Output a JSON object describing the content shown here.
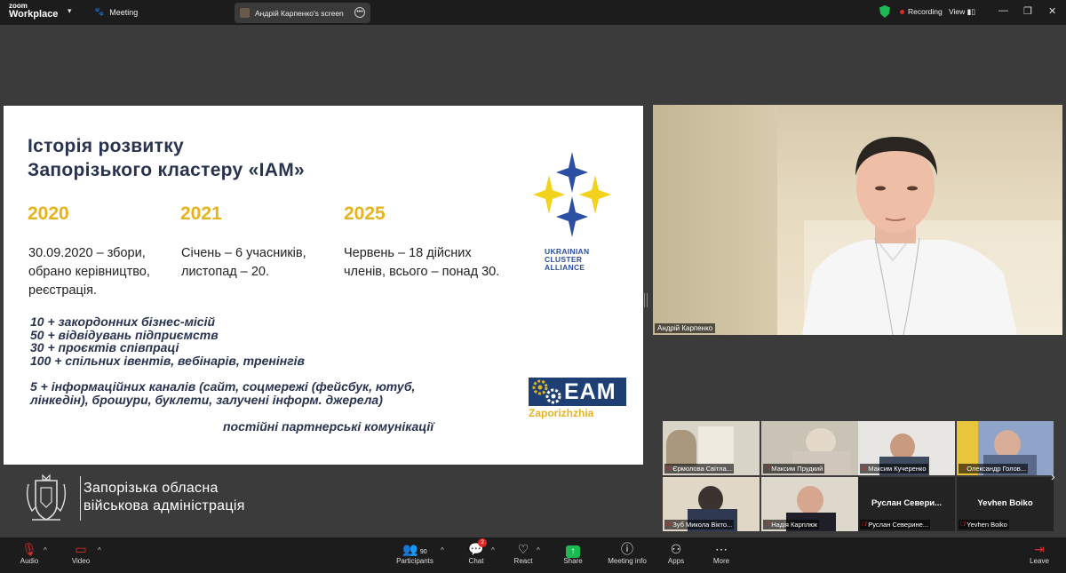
{
  "titlebar": {
    "app_name_top": "zoom",
    "app_name_bottom": "Workplace",
    "meeting_label": "Meeting",
    "share_tab": "Андрій Карпенко's screen",
    "recording_label": "Recording",
    "view_label": "View"
  },
  "slide": {
    "title_line1": "Історія розвитку",
    "title_line2": "Запорізького кластеру «IAM»",
    "years": [
      {
        "year": "2020",
        "lines": [
          "30.09.2020 – збори,",
          "обрано керівництво,",
          "реєстрація."
        ]
      },
      {
        "year": "2021",
        "lines": [
          "Січень – 6 учасників,",
          "листопад – 20."
        ]
      },
      {
        "year": "2025",
        "lines": [
          "Червень – 18 дійсних",
          "членів, всього – понад 30."
        ]
      }
    ],
    "stats": [
      "10 + закордонних бізнес-місій",
      "50 + відвідувань підприємств",
      "30 + проєктів співпраці",
      "100 + спільних івентів, вебінарів, тренінгів"
    ],
    "channels_line1": "5 + інформаційних каналів (сайт, соцмережі (фейсбук, ютуб,",
    "channels_line2": "лінкедін), брошури, буклети, залучені інформ. джерела)",
    "partner_line": "постійні партнерські комунікації",
    "uca_logo_lines": [
      "UKRAINIAN",
      "CLUSTER",
      "ALLIANCE"
    ],
    "eam_logo": "EAM",
    "eam_logo_sub": "Zaporizhzhia"
  },
  "organization": {
    "line1": "Запорізька обласна",
    "line2": "військова адміністрація"
  },
  "main_video": {
    "name": "Андрій Карпенко"
  },
  "participants": [
    {
      "name": "Єрмолова Світла...",
      "muted": true,
      "bg": "#d9d4c8"
    },
    {
      "name": "Максим Прудкий",
      "muted": true,
      "bg": "#c9c3b5"
    },
    {
      "name": "Максим Кучеренко",
      "muted": true,
      "bg": "#e8e6e2"
    },
    {
      "name": "Олександр Голов...",
      "muted": true,
      "bg": "#8fa4c8"
    },
    {
      "name": "Зуб Микола Вікто...",
      "muted": true,
      "bg": "#e1d7c6"
    },
    {
      "name": "Надія Карплюк",
      "muted": true,
      "bg": "#ded7cc"
    },
    {
      "name": "Руслан Северине...",
      "muted": true,
      "bg": "#232323",
      "display": "Руслан Севери..."
    },
    {
      "name": "Yevhen Boiko",
      "muted": true,
      "bg": "#232323",
      "display": "Yevhen Boiko"
    }
  ],
  "toolbar": {
    "audio": "Audio",
    "video": "Video",
    "participants": "Participants",
    "participants_count": "90",
    "chat": "Chat",
    "chat_badge": "2",
    "react": "React",
    "share": "Share",
    "meeting_info": "Meeting info",
    "apps": "Apps",
    "more": "More",
    "leave": "Leave"
  },
  "colors": {
    "accent_yellow": "#e6b31e",
    "title_navy": "#28334f",
    "uca_blue": "#2a4fa3",
    "eam_navy": "#1e3f74",
    "share_green": "#1db954",
    "record_red": "#e02828"
  }
}
